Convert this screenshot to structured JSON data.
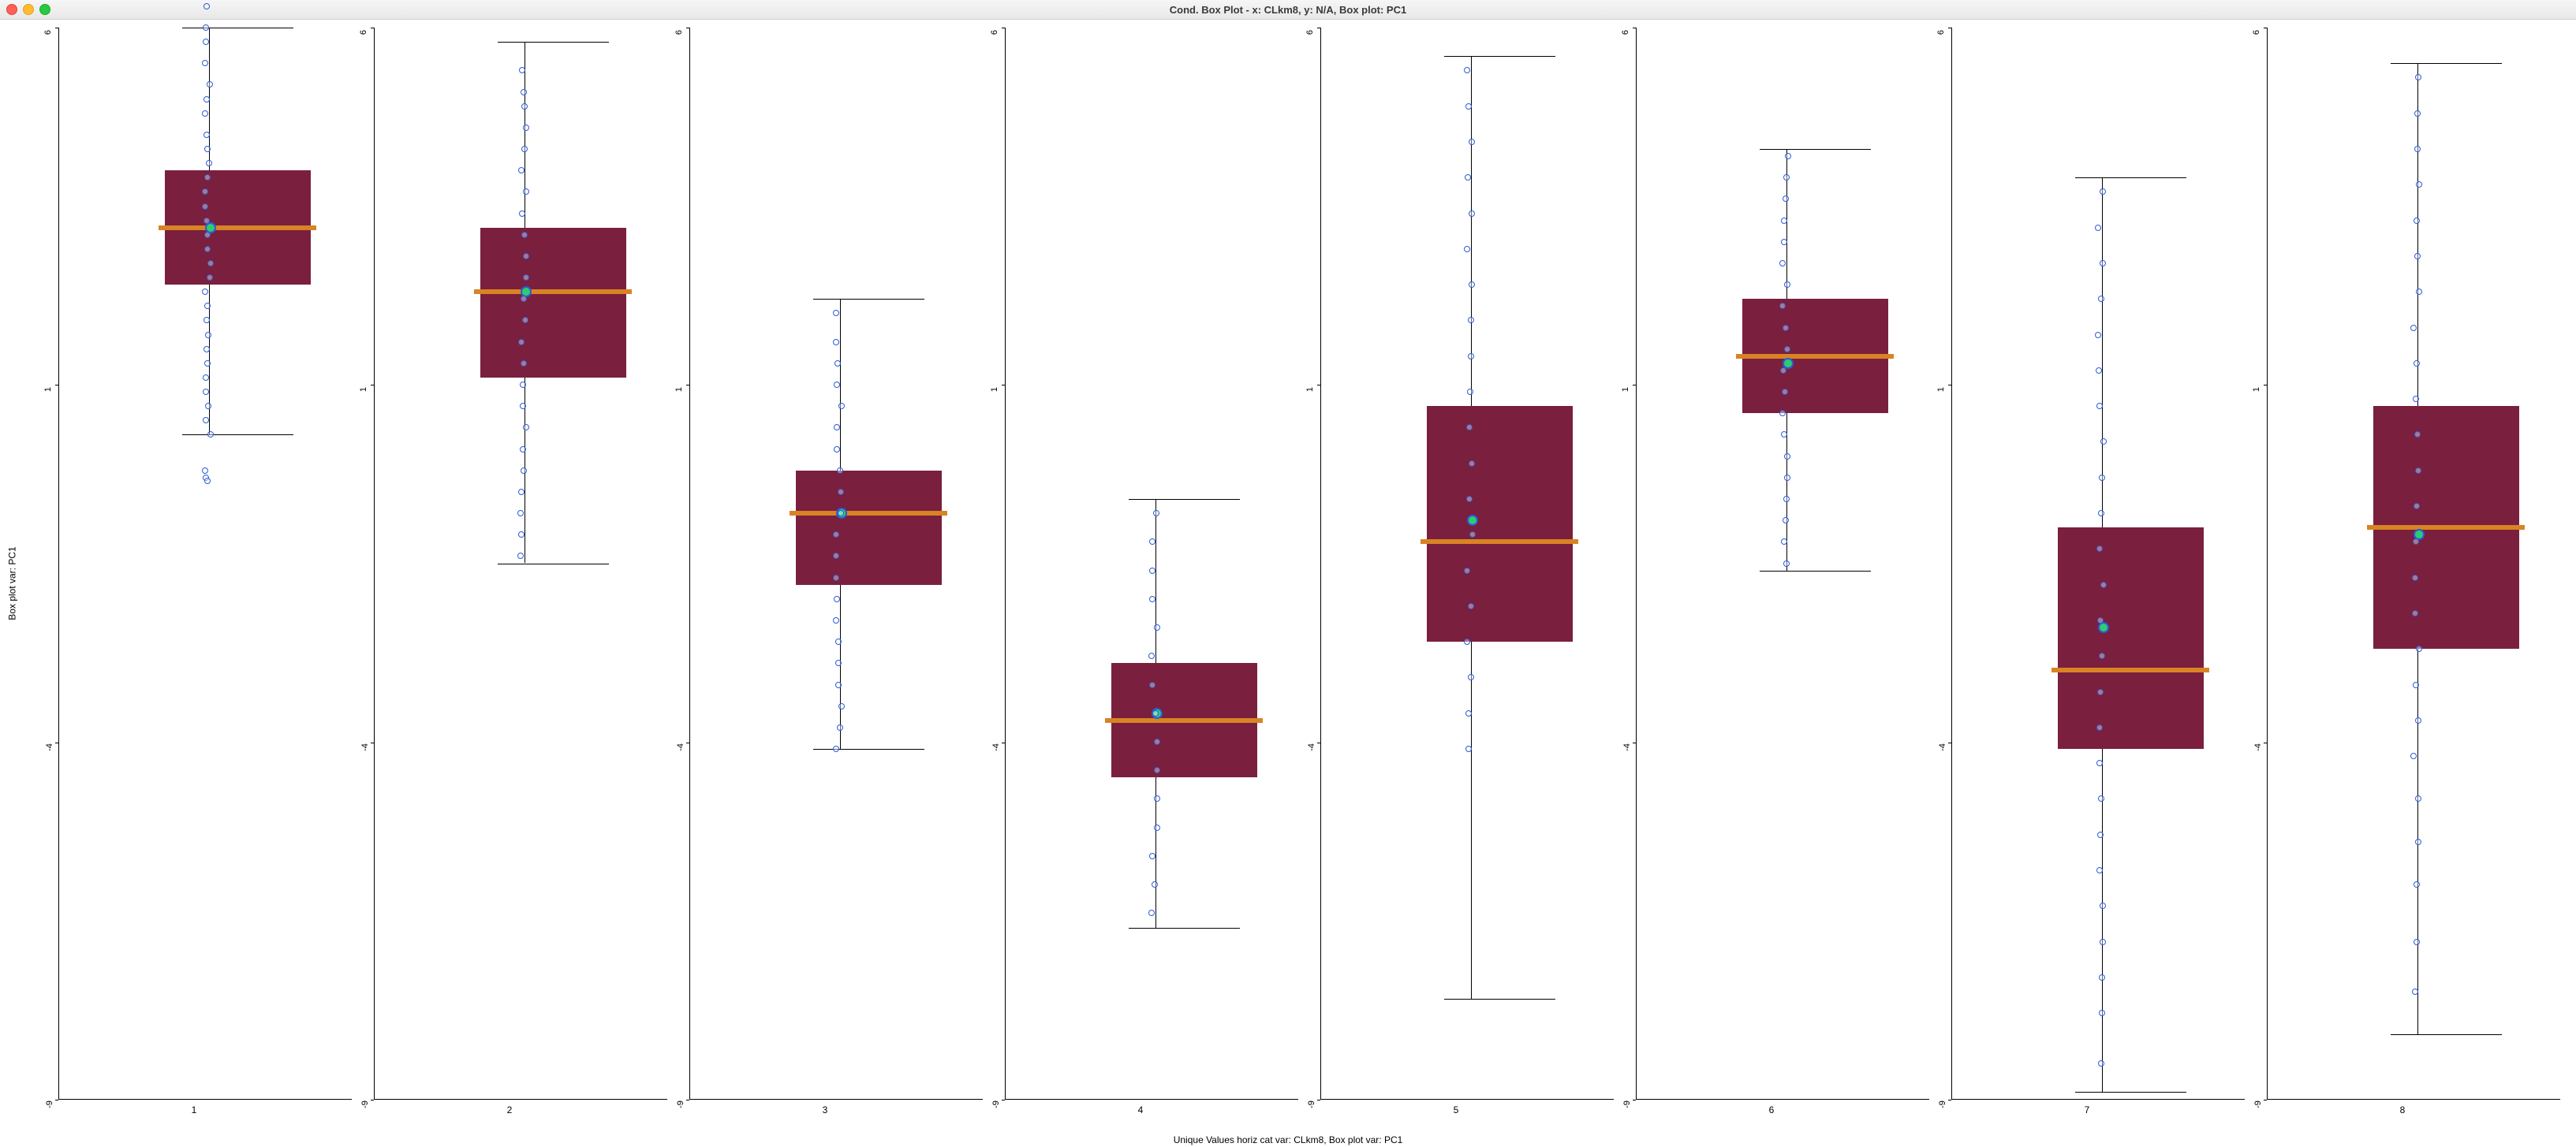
{
  "window": {
    "title": "Cond. Box Plot - x: CLkm8, y: N/A, Box plot: PC1"
  },
  "labels": {
    "ylabel": "Box plot var: PC1",
    "xlabel": "Unique Values horiz cat var: CLkm8,   Box plot var: PC1"
  },
  "y_axis": {
    "min": -9,
    "max": 6,
    "ticks": [
      -9,
      -4,
      1,
      6
    ]
  },
  "chart_data": {
    "type": "boxplot",
    "title": "Cond. Box Plot - x: CLkm8, y: N/A, Box plot: PC1",
    "xlabel": "Unique Values horiz cat var: CLkm8,   Box plot var: PC1",
    "ylabel": "Box plot var: PC1",
    "ylim": [
      -9,
      6
    ],
    "yticks": [
      -9,
      -4,
      1,
      6
    ],
    "categories": [
      "1",
      "2",
      "3",
      "4",
      "5",
      "6",
      "7",
      "8"
    ],
    "series": [
      {
        "name": "1",
        "q1": 2.4,
        "median": 3.2,
        "q3": 4.0,
        "whisker_low": 0.3,
        "whisker_high": 6.0,
        "mean": 3.2,
        "points": [
          6.6,
          6.3,
          6.0,
          5.8,
          5.5,
          5.2,
          5.0,
          4.8,
          4.5,
          4.3,
          4.1,
          3.9,
          3.7,
          3.5,
          3.3,
          3.1,
          2.9,
          2.7,
          2.5,
          2.3,
          2.1,
          1.9,
          1.7,
          1.5,
          1.3,
          1.1,
          0.9,
          0.7,
          0.5,
          0.3,
          -0.2,
          -0.3,
          -0.35
        ]
      },
      {
        "name": "2",
        "q1": 1.1,
        "median": 2.3,
        "q3": 3.2,
        "whisker_low": -1.5,
        "whisker_high": 5.8,
        "mean": 2.3,
        "points": [
          5.4,
          5.1,
          4.9,
          4.6,
          4.3,
          4.0,
          3.7,
          3.4,
          3.1,
          2.8,
          2.5,
          2.2,
          1.9,
          1.6,
          1.3,
          1.0,
          0.7,
          0.4,
          0.1,
          -0.2,
          -0.5,
          -0.8,
          -1.1,
          -1.4
        ]
      },
      {
        "name": "3",
        "q1": -1.8,
        "median": -0.8,
        "q3": -0.2,
        "whisker_low": -4.1,
        "whisker_high": 2.2,
        "mean": -0.8,
        "points": [
          2.0,
          1.6,
          1.3,
          1.0,
          0.7,
          0.4,
          0.1,
          -0.2,
          -0.5,
          -0.8,
          -1.1,
          -1.4,
          -1.7,
          -2.0,
          -2.3,
          -2.6,
          -2.9,
          -3.2,
          -3.5,
          -3.8,
          -4.1
        ]
      },
      {
        "name": "4",
        "q1": -4.5,
        "median": -3.7,
        "q3": -2.9,
        "whisker_low": -6.6,
        "whisker_high": -0.6,
        "mean": -3.6,
        "points": [
          -0.8,
          -1.2,
          -1.6,
          -2.0,
          -2.4,
          -2.8,
          -3.2,
          -3.6,
          -4.0,
          -4.4,
          -4.8,
          -5.2,
          -5.6,
          -6.0,
          -6.4
        ]
      },
      {
        "name": "5",
        "q1": -2.6,
        "median": -1.2,
        "q3": 0.7,
        "whisker_low": -7.6,
        "whisker_high": 5.6,
        "mean": -0.9,
        "points": [
          5.4,
          4.9,
          4.4,
          3.9,
          3.4,
          2.9,
          2.4,
          1.9,
          1.4,
          0.9,
          0.4,
          -0.1,
          -0.6,
          -1.1,
          -1.6,
          -2.1,
          -2.6,
          -3.1,
          -3.6,
          -4.1
        ]
      },
      {
        "name": "6",
        "q1": 0.6,
        "median": 1.4,
        "q3": 2.2,
        "whisker_low": -1.6,
        "whisker_high": 4.3,
        "mean": 1.3,
        "points": [
          4.2,
          3.9,
          3.6,
          3.3,
          3.0,
          2.7,
          2.4,
          2.1,
          1.8,
          1.5,
          1.2,
          0.9,
          0.6,
          0.3,
          0.0,
          -0.3,
          -0.6,
          -0.9,
          -1.2,
          -1.5
        ]
      },
      {
        "name": "7",
        "q1": -4.1,
        "median": -3.0,
        "q3": -1.0,
        "whisker_low": -8.9,
        "whisker_high": 3.9,
        "mean": -2.4,
        "points": [
          3.7,
          3.2,
          2.7,
          2.2,
          1.7,
          1.2,
          0.7,
          0.2,
          -0.3,
          -0.8,
          -1.3,
          -1.8,
          -2.3,
          -2.8,
          -3.3,
          -3.8,
          -4.3,
          -4.8,
          -5.3,
          -5.8,
          -6.3,
          -6.8,
          -7.3,
          -7.8,
          -8.5
        ]
      },
      {
        "name": "8",
        "q1": -2.7,
        "median": -1.0,
        "q3": 0.7,
        "whisker_low": -8.1,
        "whisker_high": 5.5,
        "mean": -1.1,
        "points": [
          5.3,
          4.8,
          4.3,
          3.8,
          3.3,
          2.8,
          2.3,
          1.8,
          1.3,
          0.8,
          0.3,
          -0.2,
          -0.7,
          -1.2,
          -1.7,
          -2.2,
          -2.7,
          -3.2,
          -3.7,
          -4.2,
          -4.8,
          -5.4,
          -6.0,
          -6.8,
          -7.5
        ]
      }
    ]
  }
}
